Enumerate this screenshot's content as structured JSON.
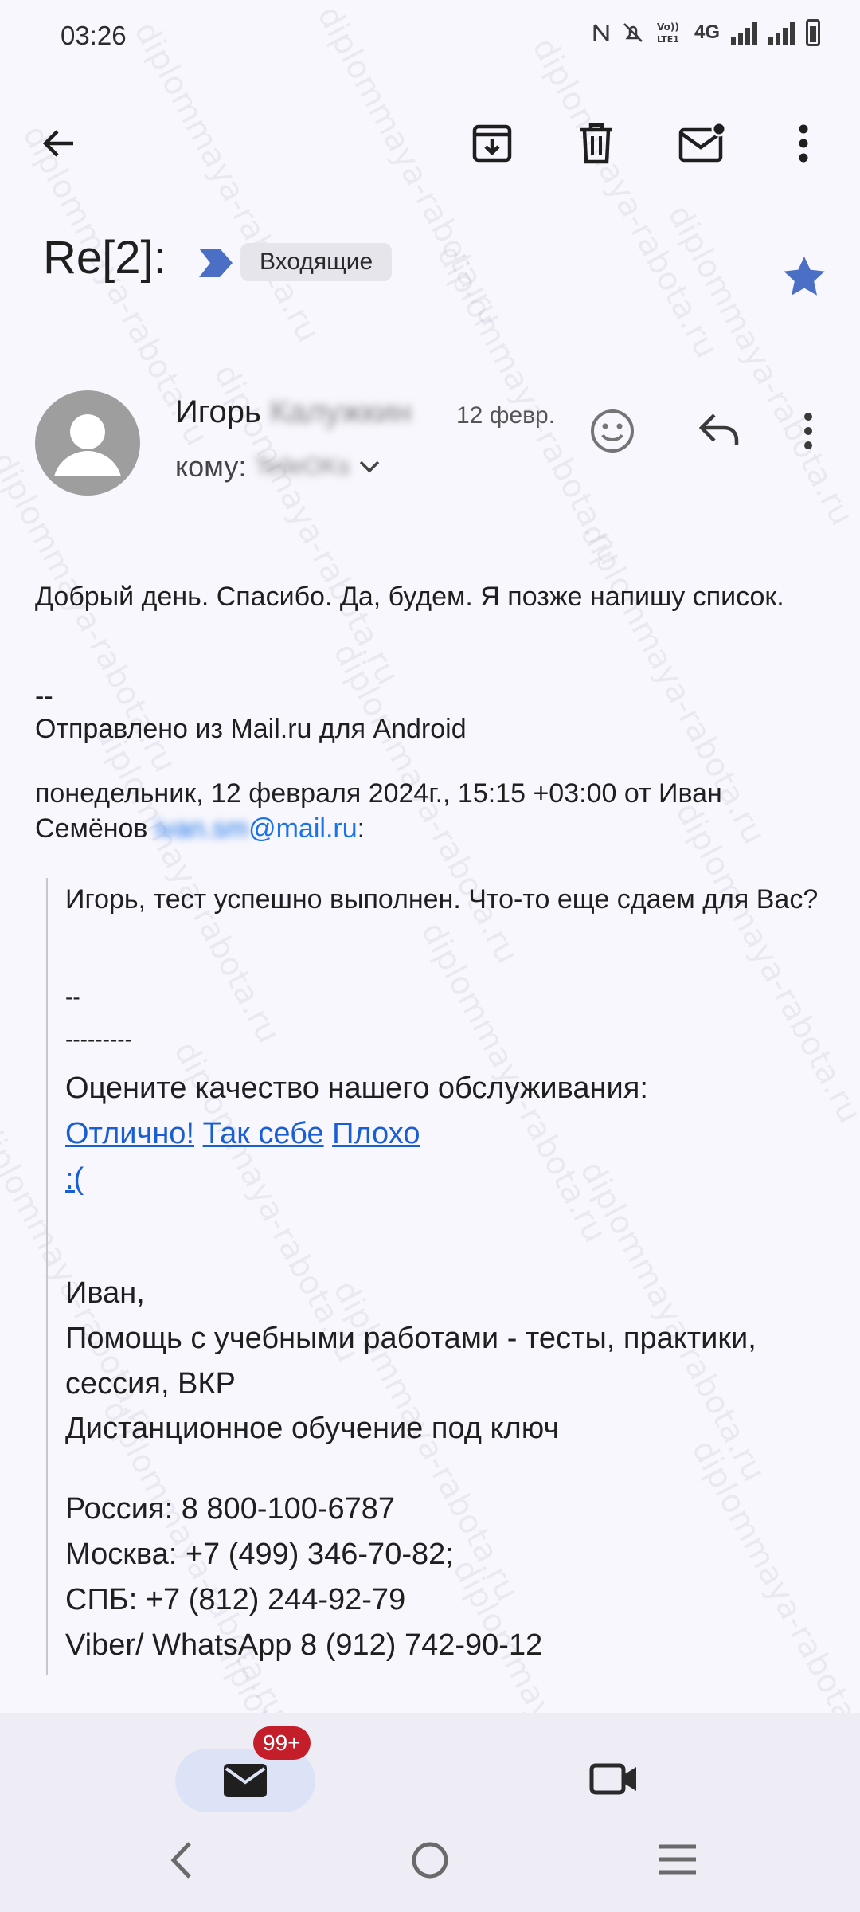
{
  "status_bar": {
    "time": "03:26",
    "network": "4G",
    "icons": [
      "nfc-icon",
      "mute-icon",
      "volte-icon",
      "signal-icon",
      "battery-icon"
    ]
  },
  "toolbar": {
    "icons": [
      "back-arrow-icon",
      "archive-icon",
      "delete-icon",
      "mark-unread-icon",
      "more-vert-icon"
    ]
  },
  "email": {
    "subject": "Re[2]:",
    "label": "Входящие",
    "starred": true,
    "sender_first_name": "Игорь",
    "sender_last_name_blurred": "Калужкин",
    "date": "12 февр.",
    "to_label": "кому:",
    "to_value_blurred": "TeileOKs",
    "body_main": "Добрый день.  Спасибо.  Да, будем. Я позже напишу список.",
    "sig_dashes": "--",
    "sent_from": "Отправлено из Mail.ru для Android",
    "quote_header": "понедельник, 12 февраля 2024г., 15:15 +03:00 от Иван Семёнов",
    "quote_email_blurred": "ivan.sm",
    "quote_email_domain": "@mail.ru",
    "quote_colon": ":"
  },
  "quoted": {
    "line1": "Игорь, тест успешно выполнен. Что-то еще сдаем для Вас?",
    "dashes1": "--",
    "dashes2": "---------",
    "rate_prompt": "Оцените качество нашего обслуживания:",
    "rate_good": "Отлично!",
    "rate_ok": "Так себе",
    "rate_bad": "Плохо",
    "rate_bad_face": ":(",
    "sig_name": "Иван,",
    "sig_line1": "Помощь с учебными работами - тесты, практики, сессия, ВКР",
    "sig_line2": "Дистанционное обучение под ключ",
    "phone_russia": "Россия: 8 800-100-6787",
    "phone_moscow": "Москва: +7 (499) 346-70-82;",
    "phone_spb": "СПБ: +7 (812) 244-92-79",
    "phone_viber": "Viber/ WhatsApp 8 (912) 742-90-12"
  },
  "bottom_nav": {
    "mail_badge": "99+"
  },
  "watermark": "diplommaya-rabota.ru",
  "colors": {
    "background": "#f8f7fd",
    "label_arrow": "#4a6fc4",
    "star": "#4a6fc4",
    "link": "#1a5ed6",
    "badge": "#c41e2a"
  }
}
